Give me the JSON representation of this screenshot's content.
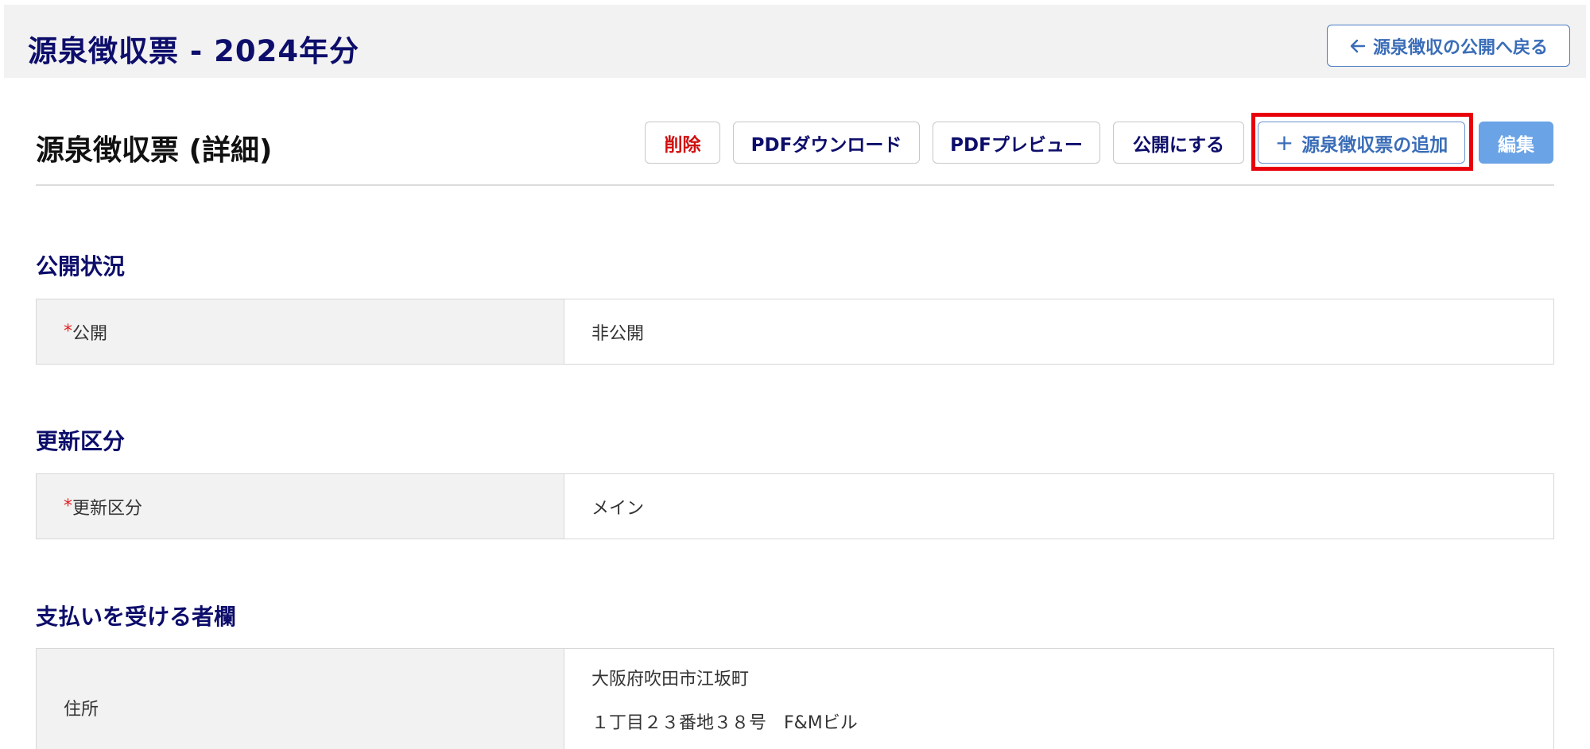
{
  "header": {
    "title": "源泉徴収票 - 2024年分",
    "back_button": "源泉徴収の公開へ戻る",
    "back_icon": "arrow-left-icon"
  },
  "detail": {
    "title": "源泉徴収票 (詳細)"
  },
  "actions": {
    "delete": "削除",
    "pdf_download": "PDFダウンロード",
    "pdf_preview": "PDFプレビュー",
    "publish": "公開にする",
    "add_plus": "+",
    "add": "源泉徴収票の追加",
    "edit": "編集"
  },
  "sections": {
    "publish_status": {
      "title": "公開状況",
      "required_mark": "*",
      "label": "公開",
      "value": "非公開"
    },
    "update_type": {
      "title": "更新区分",
      "required_mark": "*",
      "label": "更新区分",
      "value": "メイン"
    },
    "payee": {
      "title": "支払いを受ける者欄",
      "label": "住所",
      "address_line1": "大阪府吹田市江坂町",
      "address_line2": "１丁目２３番地３８号　F&Mビル"
    }
  },
  "colors": {
    "navy": "#0d0d6b",
    "accent_blue": "#3a6db8",
    "edit_bg": "#6aa3e6",
    "delete_red": "#d01010",
    "highlight_red": "#e8000b"
  }
}
